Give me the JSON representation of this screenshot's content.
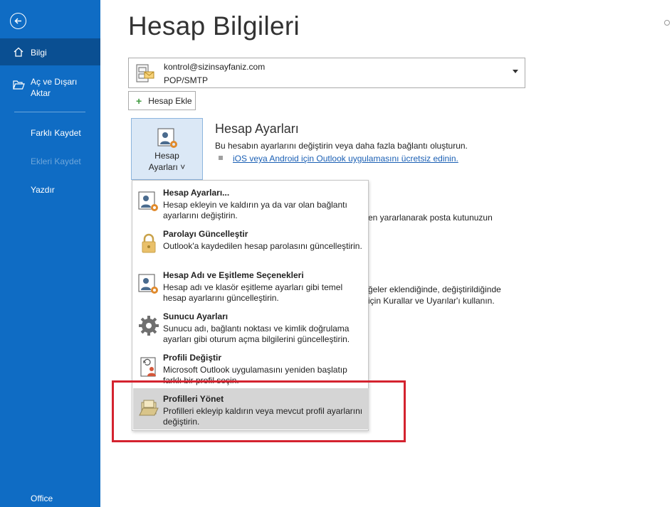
{
  "sidebar": {
    "items": [
      {
        "label": "Bilgi"
      },
      {
        "label": "Aç ve Dışarı Aktar"
      },
      {
        "label": "Farklı Kaydet"
      },
      {
        "label": "Ekleri Kaydet"
      },
      {
        "label": "Yazdır"
      },
      {
        "label": "Office"
      }
    ]
  },
  "main": {
    "title": "Hesap Bilgileri",
    "account": {
      "email": "kontrol@sizinsayfaniz.com",
      "type": "POP/SMTP"
    },
    "add_account_label": "Hesap Ekle",
    "account_settings_button": {
      "line1": "Hesap",
      "line2": "Ayarları ˅"
    },
    "section": {
      "title": "Hesap Ayarları",
      "description": "Bu hesabın ayarlarını değiştirin veya daha fazla bağlantı oluşturun.",
      "link": "iOS veya Android için Outlook uygulamasını ücretsiz edinin."
    },
    "background_texts": {
      "line1": "en yararlanarak posta kutunuzun",
      "line2": "ğeler eklendiğinde, değiştirildiğinde",
      "line3": "için Kurallar ve Uyarılar'ı kullanın."
    }
  },
  "dropdown": {
    "items": [
      {
        "title": "Hesap Ayarları...",
        "description": "Hesap ekleyin ve kaldırın ya da var olan bağlantı ayarlarını değiştirin."
      },
      {
        "title": "Parolayı Güncelleştir",
        "description": "Outlook'a kaydedilen hesap parolasını güncelleştirin."
      },
      {
        "title": "Hesap Adı ve Eşitleme Seçenekleri",
        "description": "Hesap adı ve klasör eşitleme ayarları gibi temel hesap ayarlarını güncelleştirin."
      },
      {
        "title": "Sunucu Ayarları",
        "description": "Sunucu adı, bağlantı noktası ve kimlik doğrulama ayarları gibi oturum açma bilgilerini güncelleştirin."
      },
      {
        "title": "Profili Değiştir",
        "description": "Microsoft Outlook uygulamasını yeniden başlatıp farklı bir profil seçin."
      },
      {
        "title": "Profilleri Yönet",
        "description": "Profilleri ekleyip kaldırın veya mevcut profil ayarlarını değiştirin."
      }
    ]
  },
  "colors": {
    "sidebar": "#0f6cc4",
    "sidebar_active": "#0a4f92",
    "highlight_box": "#d4232f",
    "link": "#1a5fb4"
  }
}
